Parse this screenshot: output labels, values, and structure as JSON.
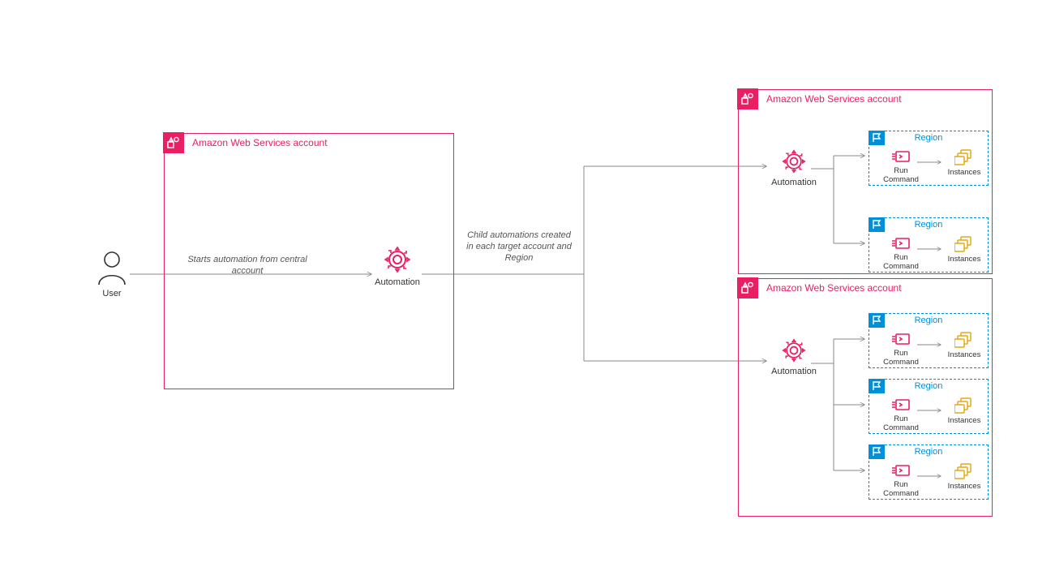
{
  "user_label": "User",
  "central_account_title": "Amazon Web Services account",
  "automation_label": "Automation",
  "annotation1": "Starts automation from central account",
  "annotation2": "Child automations created in each target account and Region",
  "target_account_title": "Amazon Web Services account",
  "region_title": "Region",
  "run_command_label": "Run Command",
  "instances_label": "Instances"
}
